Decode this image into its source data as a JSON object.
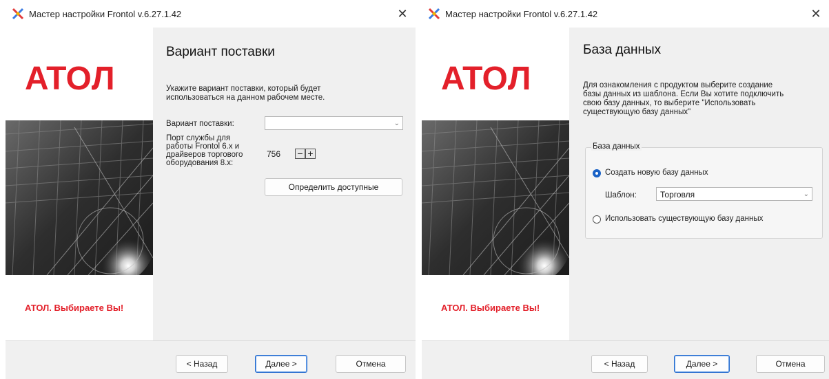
{
  "windows": [
    {
      "title": "Мастер настройки Frontol v.6.27.1.42",
      "close_glyph": "✕",
      "logo_text": "ATOЛ",
      "slogan": "АТОЛ. Выбираете Вы!",
      "page_title": "Вариант поставки",
      "description": [
        "Укажите вариант поставки, который будет",
        "использоваться на данном рабочем месте."
      ],
      "supply_label": "Вариант поставки:",
      "supply_value": "",
      "port_label": [
        "Порт службы для",
        "работы Frontol 6.x и",
        "драйверов торгового",
        "оборудования 8.x:"
      ],
      "port_value": "756",
      "minus_glyph": "−",
      "plus_glyph": "+",
      "detect_button": "Определить доступные",
      "buttons": {
        "back": "< Назад",
        "next": "Далее >",
        "cancel": "Отмена"
      }
    },
    {
      "title": "Мастер настройки Frontol v.6.27.1.42",
      "close_glyph": "✕",
      "logo_text": "ATOЛ",
      "slogan": "АТОЛ. Выбираете Вы!",
      "page_title": "База данных",
      "description": [
        "Для ознакомления с продуктом выберите создание",
        "базы данных из шаблона. Если Вы хотите подключить",
        "свою базу данных, то выберите \"Использовать",
        "существующую базу данных\""
      ],
      "group_title": "База данных",
      "radio_create": {
        "label": "Создать новую базу данных",
        "checked": true
      },
      "template_label": "Шаблон:",
      "template_value": "Торговля",
      "radio_existing": {
        "label": "Использовать существующую базу данных",
        "checked": false
      },
      "buttons": {
        "back": "< Назад",
        "next": "Далее >",
        "cancel": "Отмена"
      }
    }
  ],
  "colors": {
    "brand_red": "#e3202a",
    "accent_blue": "#1a62c6"
  },
  "icons": [
    "frontol-app-icon",
    "close-icon",
    "chevron-down-icon",
    "minus-icon",
    "plus-icon",
    "radio-icon"
  ]
}
